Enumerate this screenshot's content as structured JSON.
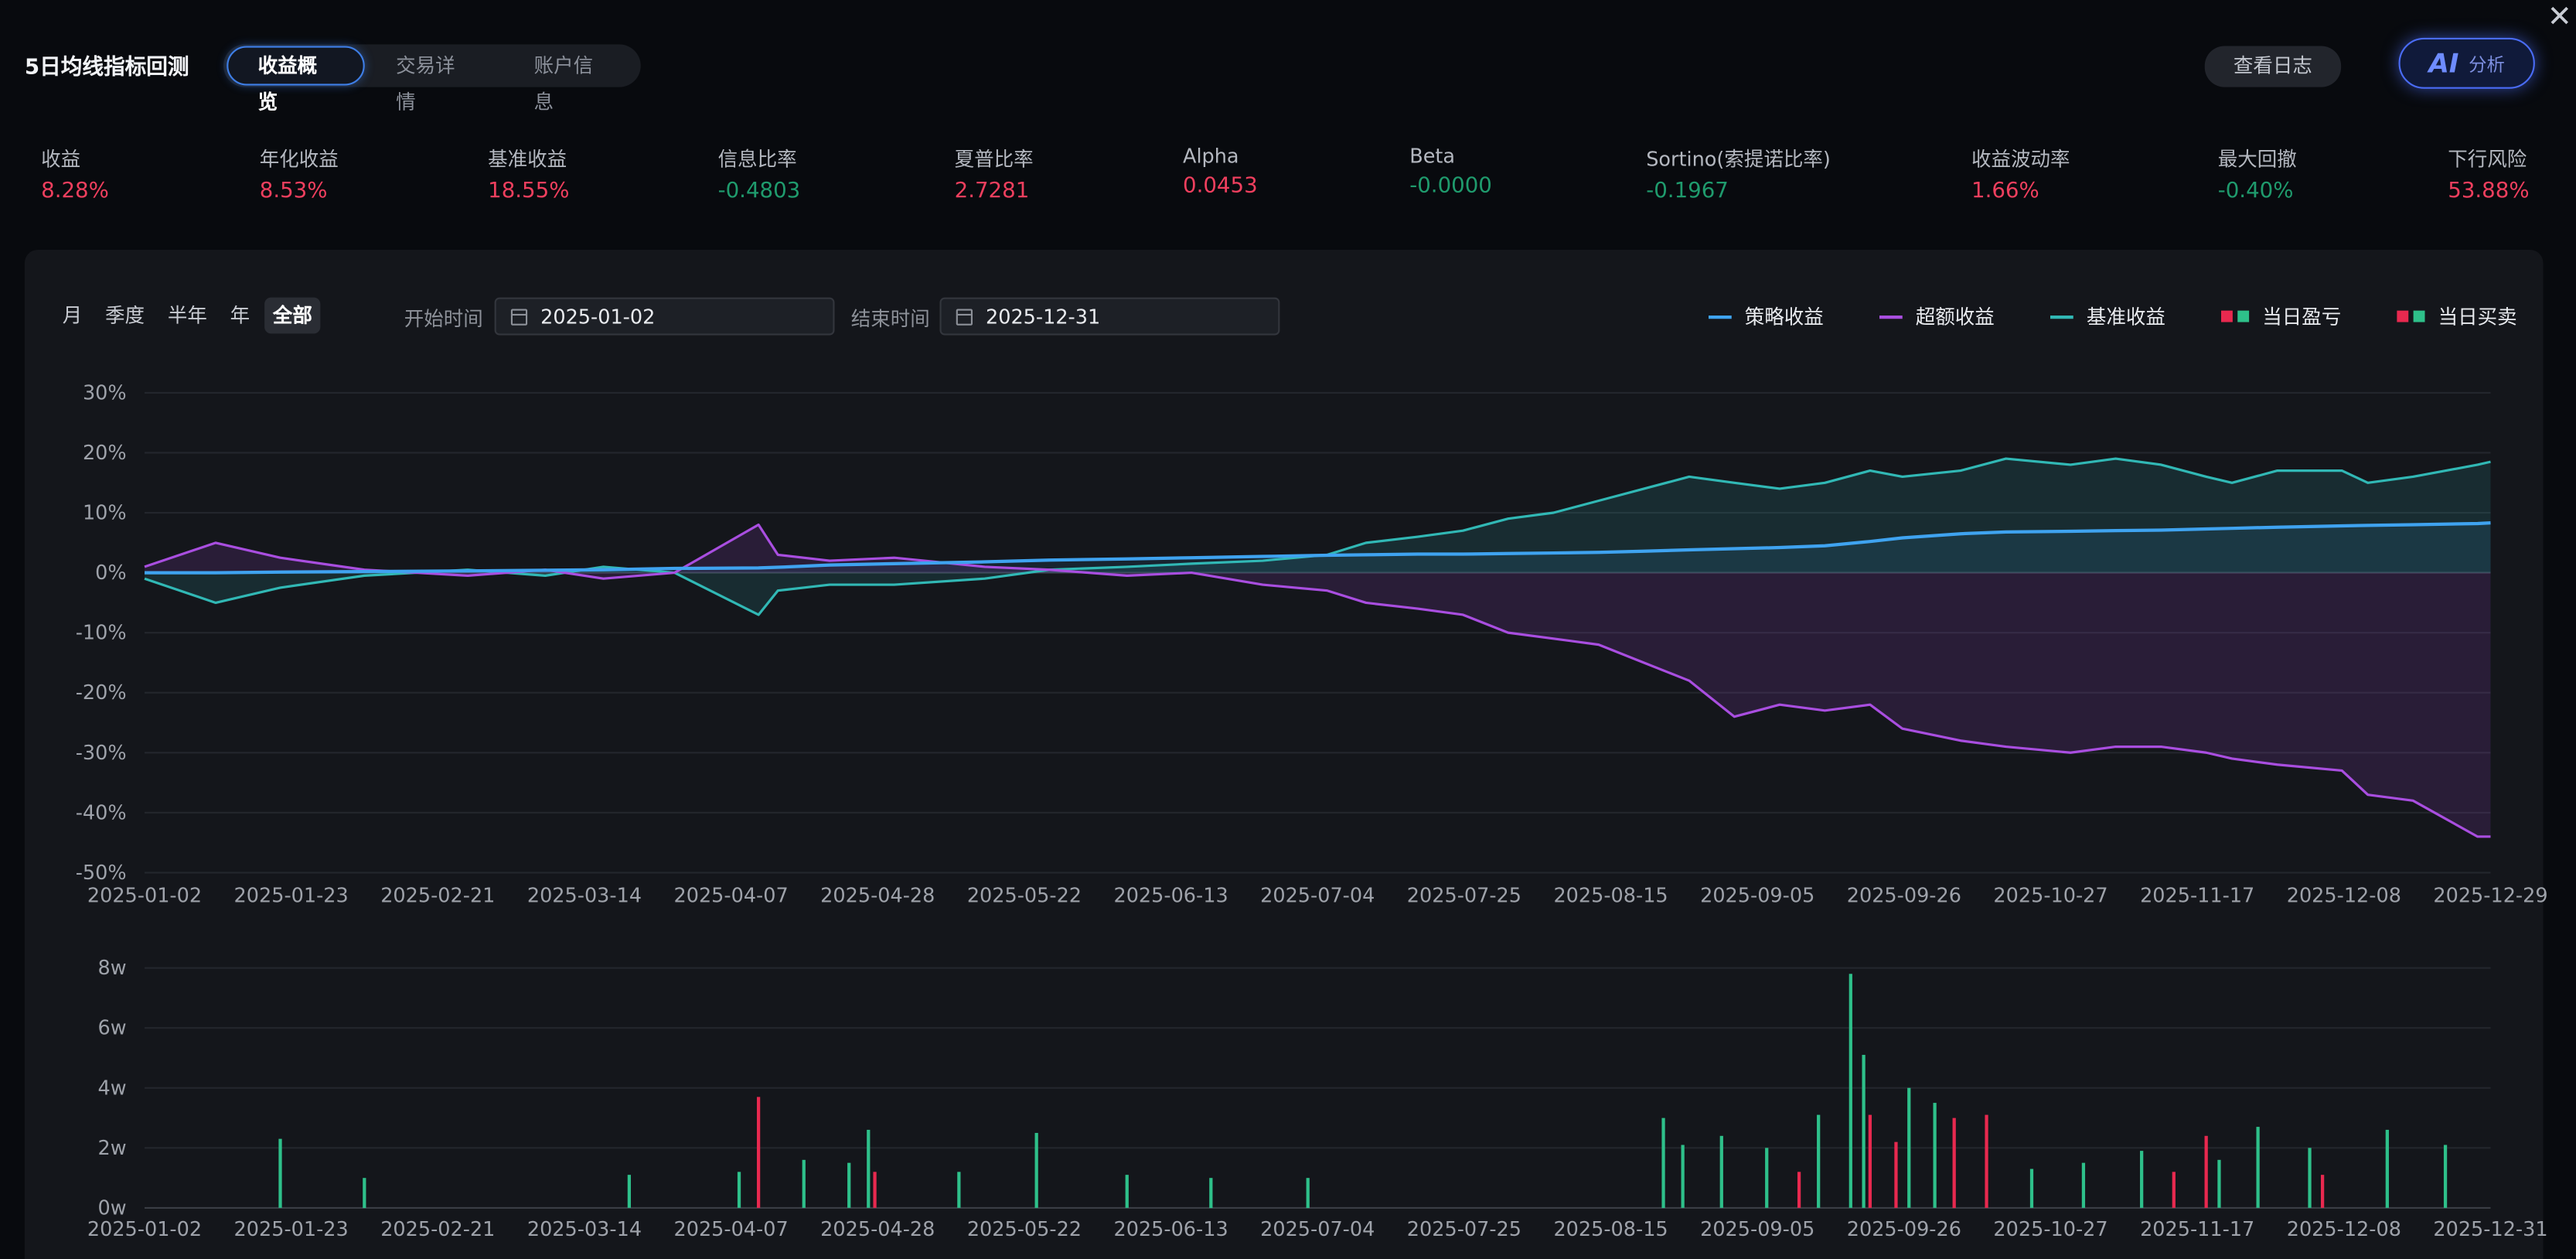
{
  "header": {
    "title": "5日均线指标回测",
    "tabs": [
      {
        "label": "收益概览",
        "active": true
      },
      {
        "label": "交易详情",
        "active": false
      },
      {
        "label": "账户信息",
        "active": false
      }
    ],
    "log_button": "查看日志",
    "ai_button": {
      "glyph": "AI",
      "label": "分析"
    },
    "close_icon": "close-icon"
  },
  "metrics": [
    {
      "label": "收益",
      "value": "8.28%",
      "tone": "pos"
    },
    {
      "label": "年化收益",
      "value": "8.53%",
      "tone": "pos"
    },
    {
      "label": "基准收益",
      "value": "18.55%",
      "tone": "pos"
    },
    {
      "label": "信息比率",
      "value": "-0.4803",
      "tone": "neg"
    },
    {
      "label": "夏普比率",
      "value": "2.7281",
      "tone": "pos"
    },
    {
      "label": "Alpha",
      "value": "0.0453",
      "tone": "pos"
    },
    {
      "label": "Beta",
      "value": "-0.0000",
      "tone": "neg"
    },
    {
      "label": "Sortino(索提诺比率)",
      "value": "-0.1967",
      "tone": "neg"
    },
    {
      "label": "收益波动率",
      "value": "1.66%",
      "tone": "pos"
    },
    {
      "label": "最大回撤",
      "value": "-0.40%",
      "tone": "neg"
    },
    {
      "label": "下行风险",
      "value": "53.88%",
      "tone": "pos"
    }
  ],
  "controls": {
    "periods": [
      {
        "label": "月",
        "active": false
      },
      {
        "label": "季度",
        "active": false
      },
      {
        "label": "半年",
        "active": false
      },
      {
        "label": "年",
        "active": false
      },
      {
        "label": "全部",
        "active": true
      }
    ],
    "start_label": "开始时间",
    "start_value": "2025-01-02",
    "end_label": "结束时间",
    "end_value": "2025-12-31"
  },
  "legend": [
    {
      "label": "策略收益",
      "type": "line",
      "color": "#3fa3f0"
    },
    {
      "label": "超额收益",
      "type": "line",
      "color": "#a94ee0"
    },
    {
      "label": "基准收益",
      "type": "line",
      "color": "#31b8b5"
    },
    {
      "label": "当日盈亏",
      "type": "squares",
      "colors": [
        "#e8294f",
        "#2ec08a"
      ]
    },
    {
      "label": "当日买卖",
      "type": "squares",
      "colors": [
        "#e8294f",
        "#2ec08a"
      ]
    }
  ],
  "colors": {
    "strategy": "#3fa3f0",
    "excess": "#a94ee0",
    "benchmark": "#31b8b5",
    "buy": "#e8294f",
    "sell": "#2ec08a"
  },
  "chart_data": [
    {
      "type": "line",
      "title": "",
      "x_tick_labels": [
        "2025-01-02",
        "2025-01-23",
        "2025-02-21",
        "2025-03-14",
        "2025-04-07",
        "2025-04-28",
        "2025-05-22",
        "2025-06-13",
        "2025-07-04",
        "2025-07-25",
        "2025-08-15",
        "2025-09-05",
        "2025-09-26",
        "2025-10-27",
        "2025-11-17",
        "2025-12-08",
        "2025-12-29"
      ],
      "ylim": [
        -50,
        30
      ],
      "y_ticks": [
        30,
        20,
        10,
        0,
        -10,
        -20,
        -30,
        -40,
        -50
      ],
      "y_unit": "%",
      "grid": true,
      "legend_position": "top-right",
      "x": [
        "2025-01-02",
        "2025-01-13",
        "2025-01-23",
        "2025-02-05",
        "2025-02-21",
        "2025-03-05",
        "2025-03-14",
        "2025-03-25",
        "2025-04-07",
        "2025-04-10",
        "2025-04-18",
        "2025-04-28",
        "2025-05-12",
        "2025-05-22",
        "2025-06-03",
        "2025-06-13",
        "2025-06-24",
        "2025-07-04",
        "2025-07-10",
        "2025-07-18",
        "2025-07-25",
        "2025-08-01",
        "2025-08-08",
        "2025-08-15",
        "2025-08-22",
        "2025-08-29",
        "2025-09-05",
        "2025-09-12",
        "2025-09-19",
        "2025-09-26",
        "2025-10-01",
        "2025-10-10",
        "2025-10-17",
        "2025-10-27",
        "2025-11-03",
        "2025-11-10",
        "2025-11-17",
        "2025-11-21",
        "2025-11-28",
        "2025-12-08",
        "2025-12-12",
        "2025-12-19",
        "2025-12-29",
        "2025-12-31"
      ],
      "series": [
        {
          "name": "策略收益",
          "values": [
            0,
            0,
            0.1,
            0.2,
            0.3,
            0.4,
            0.5,
            0.7,
            0.8,
            0.9,
            1.3,
            1.5,
            1.8,
            2.1,
            2.3,
            2.5,
            2.7,
            2.9,
            3.0,
            3.1,
            3.1,
            3.2,
            3.3,
            3.4,
            3.6,
            3.8,
            4.0,
            4.2,
            4.5,
            5.2,
            5.8,
            6.5,
            6.8,
            6.9,
            7.0,
            7.1,
            7.3,
            7.4,
            7.6,
            7.8,
            7.9,
            8.0,
            8.2,
            8.3
          ]
        },
        {
          "name": "超额收益",
          "values": [
            1,
            5,
            2.5,
            0.5,
            -0.5,
            0.5,
            -1,
            0,
            8,
            3,
            2,
            2.5,
            1,
            0.5,
            -0.5,
            0,
            -2,
            -3,
            -5,
            -6,
            -7,
            -10,
            -11,
            -12,
            -15,
            -18,
            -24,
            -22,
            -23,
            -22,
            -26,
            -28,
            -29,
            -30,
            -29,
            -29,
            -30,
            -31,
            -32,
            -33,
            -37,
            -38,
            -44,
            -44
          ]
        },
        {
          "name": "基准收益",
          "values": [
            -1,
            -5,
            -2.5,
            -0.5,
            0.5,
            -0.5,
            1,
            0,
            -7,
            -3,
            -2,
            -2,
            -1,
            0.5,
            1,
            1.5,
            2,
            3,
            5,
            6,
            7,
            9,
            10,
            12,
            14,
            16,
            15,
            14,
            15,
            17,
            16,
            17,
            19,
            18,
            19,
            18,
            16,
            15,
            17,
            17,
            15,
            16,
            18,
            18.5
          ]
        }
      ]
    },
    {
      "type": "bar",
      "title": "",
      "x_tick_labels": [
        "2025-01-02",
        "2025-01-23",
        "2025-02-21",
        "2025-03-14",
        "2025-04-07",
        "2025-04-28",
        "2025-05-22",
        "2025-06-13",
        "2025-07-04",
        "2025-07-25",
        "2025-08-15",
        "2025-09-05",
        "2025-09-26",
        "2025-10-27",
        "2025-11-17",
        "2025-12-08",
        "2025-12-31"
      ],
      "ylim": [
        0,
        8
      ],
      "y_ticks": [
        "8w",
        "6w",
        "4w",
        "2w",
        "0w"
      ],
      "y_unit": "w",
      "grid": true,
      "series": [
        {
          "name": "当日买卖",
          "color_key": "buy",
          "points": [
            {
              "x": "2025-04-07",
              "value": 3.7
            },
            {
              "x": "2025-04-25",
              "value": 1.2
            },
            {
              "x": "2025-09-26",
              "value": 3.1
            },
            {
              "x": "2025-09-30",
              "value": 2.2
            },
            {
              "x": "2025-10-09",
              "value": 3.0
            },
            {
              "x": "2025-10-14",
              "value": 3.1
            },
            {
              "x": "2025-11-17",
              "value": 2.4
            },
            {
              "x": "2025-12-05",
              "value": 1.1
            },
            {
              "x": "2025-09-15",
              "value": 1.2
            },
            {
              "x": "2025-11-12",
              "value": 1.2
            }
          ]
        },
        {
          "name": "当日盈亏",
          "color_key": "sell",
          "points": [
            {
              "x": "2025-01-23",
              "value": 2.3
            },
            {
              "x": "2025-02-05",
              "value": 1.0
            },
            {
              "x": "2025-03-18",
              "value": 1.1
            },
            {
              "x": "2025-04-04",
              "value": 1.2
            },
            {
              "x": "2025-04-14",
              "value": 1.6
            },
            {
              "x": "2025-04-21",
              "value": 1.5
            },
            {
              "x": "2025-04-24",
              "value": 2.6
            },
            {
              "x": "2025-05-08",
              "value": 1.2
            },
            {
              "x": "2025-05-20",
              "value": 2.5
            },
            {
              "x": "2025-06-03",
              "value": 1.1
            },
            {
              "x": "2025-06-16",
              "value": 1.0
            },
            {
              "x": "2025-07-01",
              "value": 1.0
            },
            {
              "x": "2025-08-25",
              "value": 3.0
            },
            {
              "x": "2025-08-28",
              "value": 2.1
            },
            {
              "x": "2025-09-03",
              "value": 2.4
            },
            {
              "x": "2025-09-10",
              "value": 2.0
            },
            {
              "x": "2025-09-18",
              "value": 3.1
            },
            {
              "x": "2025-09-23",
              "value": 7.8
            },
            {
              "x": "2025-09-25",
              "value": 5.1
            },
            {
              "x": "2025-10-02",
              "value": 4.0
            },
            {
              "x": "2025-10-06",
              "value": 3.5
            },
            {
              "x": "2025-10-21",
              "value": 1.3
            },
            {
              "x": "2025-10-29",
              "value": 1.5
            },
            {
              "x": "2025-11-07",
              "value": 1.9
            },
            {
              "x": "2025-11-19",
              "value": 1.6
            },
            {
              "x": "2025-11-25",
              "value": 2.7
            },
            {
              "x": "2025-12-03",
              "value": 2.0
            },
            {
              "x": "2025-12-15",
              "value": 2.6
            },
            {
              "x": "2025-12-24",
              "value": 2.1
            }
          ]
        }
      ]
    }
  ]
}
